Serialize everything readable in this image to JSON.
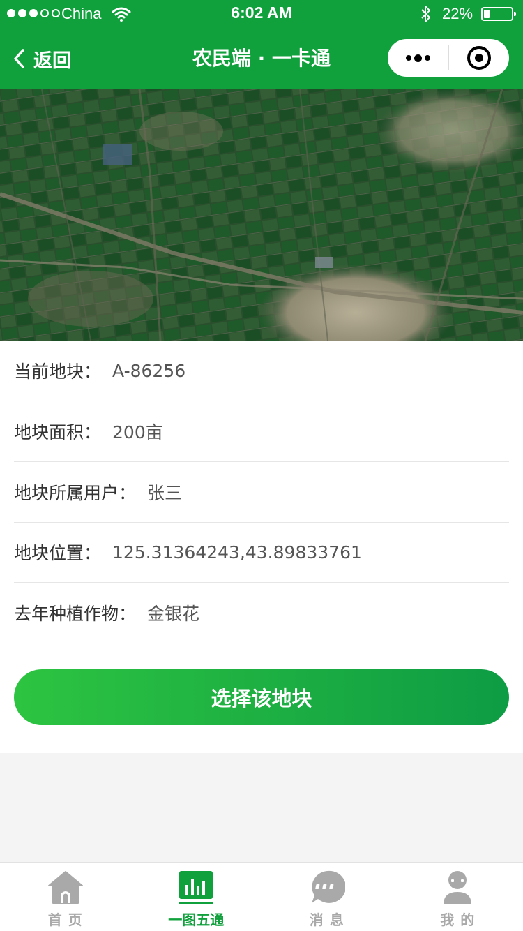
{
  "status_bar": {
    "carrier": "China",
    "time": "6:02 AM",
    "battery_percent": "22%",
    "battery_level": 0.22,
    "signal_bars_filled": 3
  },
  "nav": {
    "back_label": "返回",
    "title": "农民端 · 一卡通",
    "capsule_menu_icon": "more-dots-icon",
    "capsule_close_icon": "target-circle-icon"
  },
  "map": {
    "type": "satellite-image"
  },
  "plot_info": [
    {
      "label": "当前地块：",
      "value": "A-86256"
    },
    {
      "label": "地块面积：",
      "value": "200亩"
    },
    {
      "label": "地块所属用户：",
      "value": "张三"
    },
    {
      "label": "地块位置：",
      "value": "125.31364243,43.89833761"
    },
    {
      "label": "去年种植作物：",
      "value": "金银花"
    }
  ],
  "select_button": {
    "label": "选择该地块"
  },
  "tab_bar": {
    "active_index": 1,
    "tabs": [
      {
        "label": "首 页",
        "icon": "home-icon"
      },
      {
        "label": "一图五通",
        "icon": "bar-chart-icon"
      },
      {
        "label": "消 息",
        "icon": "message-bubble-icon"
      },
      {
        "label": "我 的",
        "icon": "user-icon"
      }
    ]
  },
  "colors": {
    "brand_green": "#10a13d",
    "button_gradient_start": "#2dc441",
    "button_gradient_end": "#0e9c44",
    "tab_inactive": "#a9a9a9"
  }
}
